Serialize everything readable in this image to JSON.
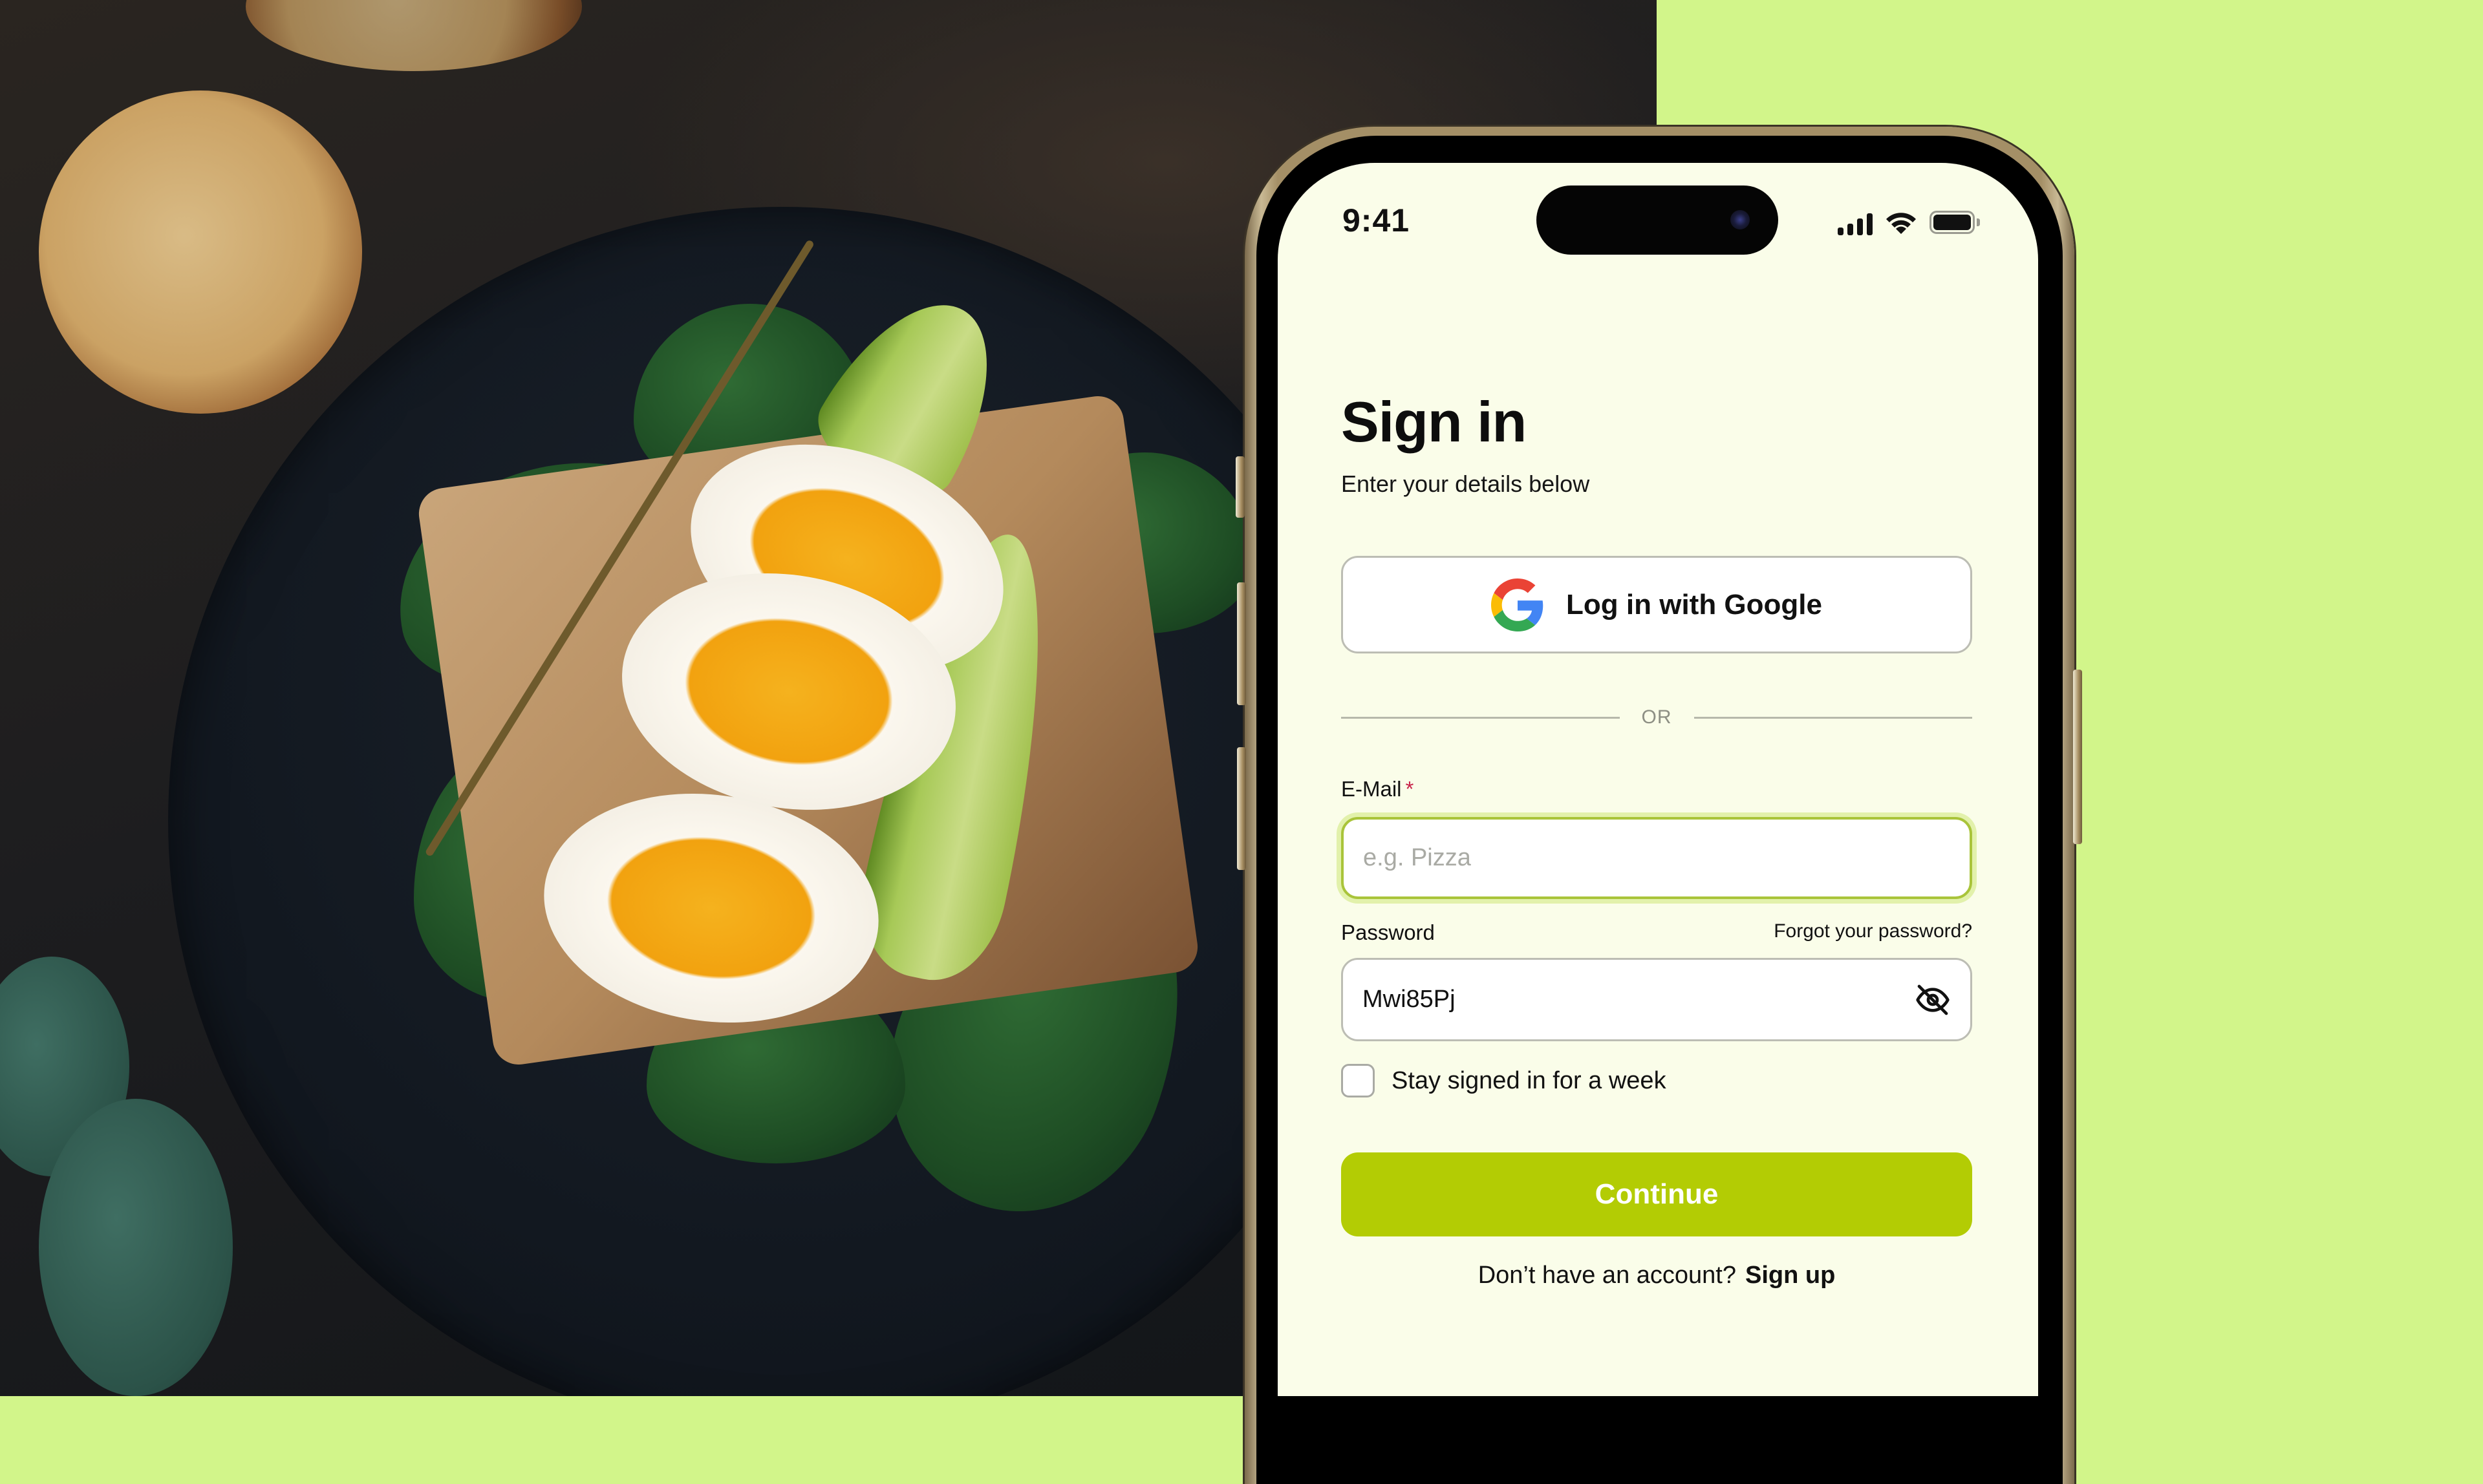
{
  "status_bar": {
    "time": "9:41",
    "icons": [
      "cellular-signal-icon",
      "wifi-icon",
      "battery-icon"
    ]
  },
  "signin": {
    "title": "Sign in",
    "subtitle": "Enter your details below",
    "google_button_label": "Log in with Google",
    "divider_text": "OR",
    "email": {
      "label": "E-Mail",
      "required_mark": "*",
      "placeholder": "e.g. Pizza",
      "value": ""
    },
    "password": {
      "label": "Password",
      "value": "Mwi85Pj",
      "forgot_link": "Forgot your password?",
      "visibility_icon": "eye-off-icon"
    },
    "remember_me": {
      "label": "Stay signed in for a week",
      "checked": false
    },
    "continue_label": "Continue",
    "signup_prompt": "Don’t have an account?",
    "signup_link": "Sign up"
  },
  "colors": {
    "page_background": "#d2f58a",
    "screen_background": "#fafde9",
    "accent": "#b3cc04",
    "focus_border": "#a9c43a",
    "required": "#c8234a",
    "phone_frame": "#a48f66"
  },
  "photo": {
    "description": "Toast with spinach, avocado slices and halved soft-boiled eggs on a dark plate"
  }
}
